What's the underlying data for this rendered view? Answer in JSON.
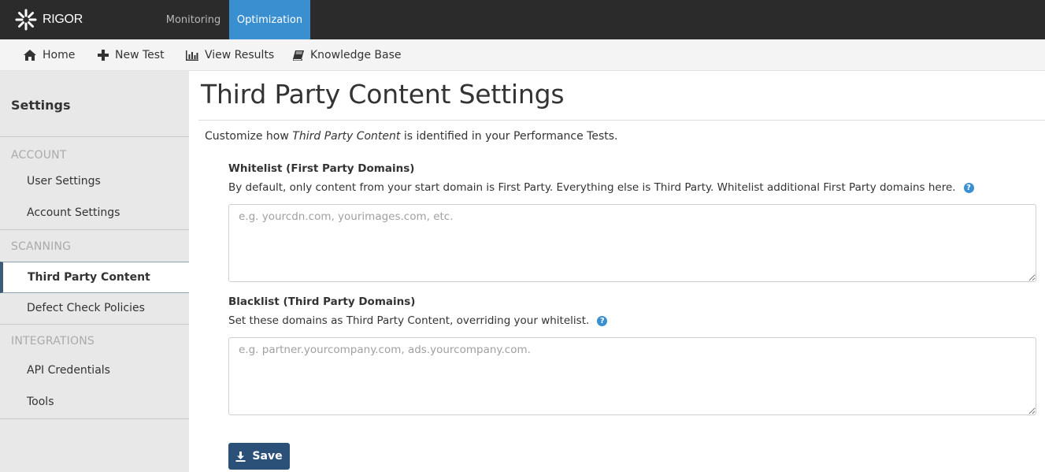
{
  "app": {
    "logo_text": "RIGOR",
    "top_tabs": [
      "Monitoring",
      "Optimization"
    ],
    "active_top_tab": "Optimization",
    "accent_color": "#3a8fd0"
  },
  "navbar": {
    "items": [
      {
        "label": "Home",
        "icon": "home-icon"
      },
      {
        "label": "New Test",
        "icon": "plus-icon"
      },
      {
        "label": "View Results",
        "icon": "bar-chart-icon"
      },
      {
        "label": "Knowledge Base",
        "icon": "book-icon"
      }
    ]
  },
  "sidebar": {
    "title": "Settings",
    "sections": [
      {
        "label": "ACCOUNT",
        "items": [
          "User Settings",
          "Account Settings"
        ]
      },
      {
        "label": "SCANNING",
        "items": [
          "Third Party Content",
          "Defect Check Policies"
        ]
      },
      {
        "label": "INTEGRATIONS",
        "items": [
          "API Credentials",
          "Tools"
        ]
      }
    ],
    "active_item": "Third Party Content"
  },
  "main": {
    "title": "Third Party Content Settings",
    "intro_before": "Customize how ",
    "intro_emphasis": "Third Party Content",
    "intro_after": " is identified in your Performance Tests.",
    "whitelist": {
      "label": "Whitelist (First Party Domains)",
      "help": "By default, only content from your start domain is First Party. Everything else is Third Party. Whitelist additional First Party domains here.",
      "placeholder": "e.g. yourcdn.com, yourimages.com, etc.",
      "value": ""
    },
    "blacklist": {
      "label": "Blacklist (Third Party Domains)",
      "help": "Set these domains as Third Party Content, overriding your whitelist.",
      "placeholder": "e.g. partner.yourcompany.com, ads.yourcompany.com.",
      "value": ""
    },
    "save_label": "Save",
    "help_glyph": "?"
  }
}
